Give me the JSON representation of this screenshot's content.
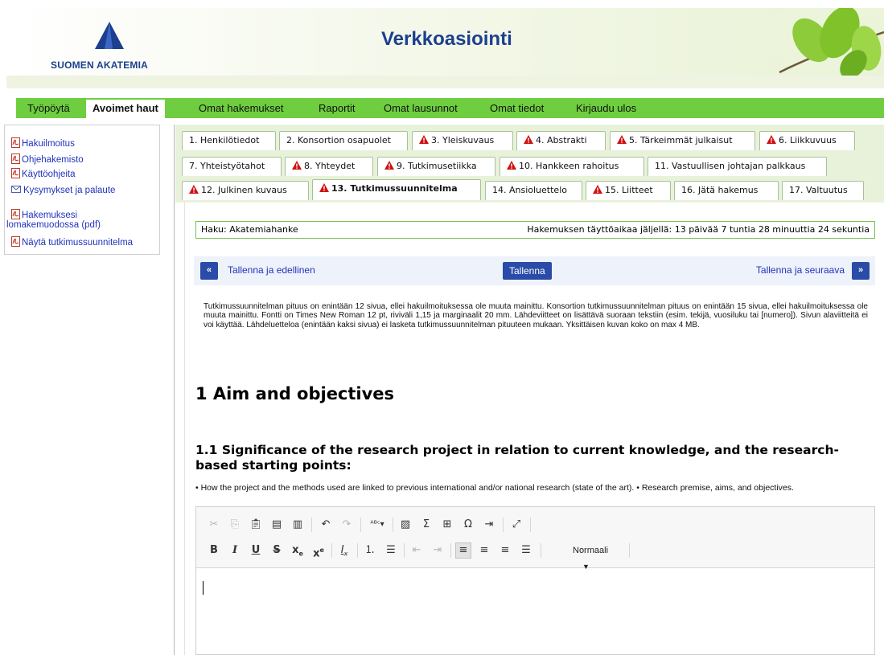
{
  "header": {
    "logo_text": "SUOMEN AKATEMIA",
    "site_title": "Verkkoasiointi"
  },
  "mainnav": {
    "items": [
      {
        "label": "Työpöytä"
      },
      {
        "label": "Avoimet haut",
        "active": true
      },
      {
        "label": "Omat hakemukset"
      },
      {
        "label": "Raportit"
      },
      {
        "label": "Omat lausunnot"
      },
      {
        "label": "Omat tiedot"
      },
      {
        "label": "Kirjaudu ulos"
      }
    ]
  },
  "sidebar": {
    "links": [
      {
        "label": "Hakuilmoitus",
        "icon": "pdf-icon"
      },
      {
        "label": "Ohjehakemisto",
        "icon": "pdf-icon"
      },
      {
        "label": "Käyttöohjeita",
        "icon": "pdf-icon"
      },
      {
        "label": "Kysymykset ja palaute",
        "icon": "mail-icon"
      },
      {
        "label": "Hakemuksesi",
        "label2": "lomakemuodossa (pdf)",
        "icon": "pdf-icon"
      },
      {
        "label": "Näytä tutkimussuunnitelma",
        "icon": "pdf-icon"
      }
    ]
  },
  "tabs": [
    {
      "label": "1. Henkilötiedot",
      "warning": false
    },
    {
      "label": "2. Konsortion osapuolet",
      "warning": false
    },
    {
      "label": "3. Yleiskuvaus",
      "warning": true
    },
    {
      "label": "4. Abstrakti",
      "warning": true
    },
    {
      "label": "5. Tärkeimmät julkaisut",
      "warning": true
    },
    {
      "label": "6. Liikkuvuus",
      "warning": true
    },
    {
      "label": "7. Yhteistyötahot",
      "warning": false
    },
    {
      "label": "8. Yhteydet",
      "warning": true
    },
    {
      "label": "9. Tutkimusetiikka",
      "warning": true
    },
    {
      "label": "10. Hankkeen rahoitus",
      "warning": true
    },
    {
      "label": "11. Vastuullisen johtajan palkkaus",
      "warning": false
    },
    {
      "label": "12. Julkinen kuvaus",
      "warning": true
    },
    {
      "label": "13. Tutkimussuunnitelma",
      "warning": true,
      "active": true
    },
    {
      "label": "14. Ansioluettelo",
      "warning": false
    },
    {
      "label": "15. Liitteet",
      "warning": true
    },
    {
      "label": "16. Jätä hakemus",
      "warning": false
    },
    {
      "label": "17. Valtuutus",
      "warning": false
    }
  ],
  "haku": {
    "label": "Haku: Akatemiahanke",
    "time_left": "Hakemuksen täyttöaikaa jäljellä: 13 päivää 7 tuntia 28 minuuttia 24 sekuntia"
  },
  "savebar": {
    "prev_glyph": "«",
    "prev_label": "Tallenna ja edellinen",
    "save_label": "Tallenna",
    "next_label": "Tallenna ja seuraava",
    "next_glyph": "»"
  },
  "instructions": "Tutkimussuunnitelman pituus on enintään 12 sivua, ellei hakuilmoituksessa ole muuta mainittu. Konsortion tutkimussuunnitelman pituus on enintään 15 sivua, ellei hakuilmoituksessa ole muuta mainittu. Fontti on Times New Roman 12 pt, riviväli 1,15 ja marginaalit 20 mm.  Lähdeviitteet on lisättävä suoraan tekstiin (esim. tekijä, vuosiluku tai [numero]). Sivun alaviitteitä ei voi käyttää. Lähdeluetteloa (enintään kaksi sivua) ei lasketa tutkimussuunnitelman pituuteen mukaan. Yksittäisen kuvan koko on max 4 MB.",
  "section": {
    "h1": "1 Aim and objectives",
    "h2": "1.1 Significance of the research project in relation to current knowledge, and the research-based starting points:",
    "bullets": "• How the project and the methods used are linked to previous international and/or national research (state of the art). • Research premise, aims, and objectives."
  },
  "editor": {
    "format_value": "Normaali",
    "toolbar_row1": [
      "cut-icon",
      "copy-icon",
      "paste-icon",
      "paste-text-icon",
      "paste-word-icon",
      "undo-icon",
      "redo-icon",
      "spellcheck-icon",
      "image-icon",
      "math-icon",
      "table-icon",
      "special-char-icon",
      "indent-list-icon",
      "maximize-icon"
    ],
    "toolbar_row2": [
      "bold-icon",
      "italic-icon",
      "underline-icon",
      "strike-icon",
      "subscript-icon",
      "superscript-icon",
      "remove-format-icon",
      "numbered-list-icon",
      "bulleted-list-icon",
      "outdent-icon",
      "indent-icon",
      "align-left-icon",
      "align-center-icon",
      "align-right-icon",
      "justify-icon",
      "format-dropdown"
    ]
  },
  "colors": {
    "nav_green": "#6fce3f",
    "brand_blue": "#1c3f8e",
    "button_blue": "#2a4ca8",
    "link_blue": "#2233bb",
    "warning_red": "#d01010"
  }
}
